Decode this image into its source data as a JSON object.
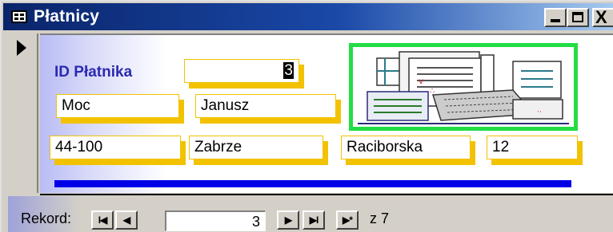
{
  "window": {
    "title": "Płatnicy",
    "controls": {
      "minimize": "minimize-icon",
      "maximize": "maximize-icon",
      "close": "close-icon",
      "close_glyph": "X"
    }
  },
  "form": {
    "id_label": "ID Płatnika",
    "id_value": "3",
    "last_name": "Moc",
    "first_name": "Janusz",
    "postal_code": "44-100",
    "city": "Zabrze",
    "street": "Raciborska",
    "house_number": "12",
    "image_icon": "forms-documents-image"
  },
  "navigation": {
    "label": "Rekord:",
    "first_glyph": "I◀",
    "prev_glyph": "◀",
    "current": "3",
    "next_glyph": "▶",
    "last_glyph": "▶I",
    "new_glyph": "▶*",
    "of_text": "z 7"
  },
  "colors": {
    "label_blue": "#2a2ab0",
    "shadow_yellow": "#f2c200",
    "frame_green": "#22dd44",
    "bar_blue": "#0000e8",
    "title_dark": "#0a246a"
  }
}
